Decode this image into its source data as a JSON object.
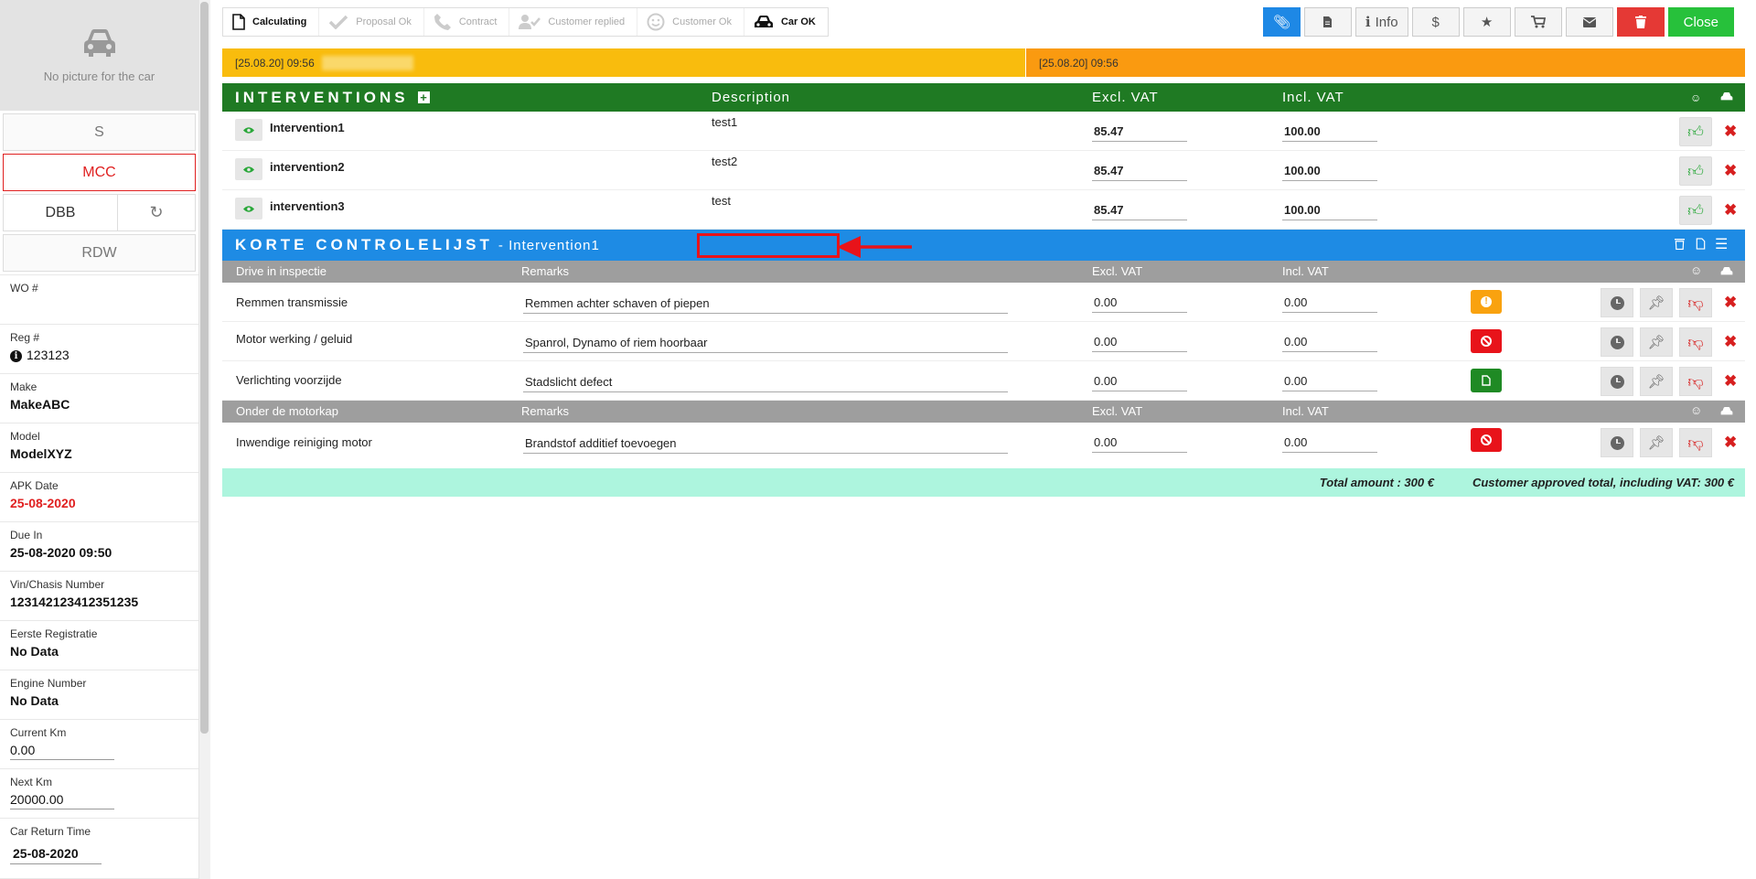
{
  "sidebar": {
    "no_picture": "No picture for the car",
    "buttons": {
      "s": "S",
      "mcc": "MCC",
      "dbb": "DBB",
      "rdw": "RDW"
    },
    "fields": [
      {
        "label": "WO #",
        "value": ""
      },
      {
        "label": "Reg #",
        "value": "123123"
      },
      {
        "label": "Make",
        "value": "MakeABC"
      },
      {
        "label": "Model",
        "value": "ModelXYZ"
      },
      {
        "label": "APK Date",
        "value": "25-08-2020"
      },
      {
        "label": "Due In",
        "value": "25-08-2020 09:50"
      },
      {
        "label": "Vin/Chasis Number",
        "value": "123142123412351235"
      },
      {
        "label": "Eerste Registratie",
        "value": "No Data"
      },
      {
        "label": "Engine Number",
        "value": "No Data"
      },
      {
        "label": "Current Km",
        "value": "0.00"
      },
      {
        "label": "Next Km",
        "value": "20000.00"
      },
      {
        "label": "Car Return Time",
        "value": "25-08-2020"
      }
    ]
  },
  "steps": [
    {
      "label": "Calculating",
      "icon": "document-icon",
      "active": true
    },
    {
      "label": "Proposal Ok",
      "icon": "check-icon",
      "active": false
    },
    {
      "label": "Contract",
      "icon": "phone-icon",
      "active": false
    },
    {
      "label": "Customer replied",
      "icon": "user-check-icon",
      "active": false
    },
    {
      "label": "Customer Ok",
      "icon": "smiley-icon",
      "active": false
    },
    {
      "label": "Car OK",
      "icon": "car-icon",
      "active": true
    }
  ],
  "toolbar": {
    "info": "Info",
    "dollar": "$",
    "close": "Close"
  },
  "notes": [
    "[25.08.20] 09:56",
    "[25.08.20] 09:56"
  ],
  "interventions": {
    "title": "INTERVENTIONS",
    "col_description": "Description",
    "col_excl": "Excl. VAT",
    "col_incl": "Incl. VAT",
    "rows": [
      {
        "name": "Intervention1",
        "description": "test1",
        "excl": "85.47",
        "incl": "100.00"
      },
      {
        "name": "intervention2",
        "description": "test2",
        "excl": "85.47",
        "incl": "100.00"
      },
      {
        "name": "intervention3",
        "description": "test",
        "excl": "85.47",
        "incl": "100.00"
      }
    ]
  },
  "checklist": {
    "title": "KORTE CONTROLELIJST",
    "subtitle": "- Intervention1",
    "groups": [
      {
        "name": "Drive in inspectie",
        "remarks": "Remarks",
        "excl": "Excl. VAT",
        "incl": "Incl. VAT",
        "items": [
          {
            "name": "Remmen transmissie",
            "remark": "Remmen achter schaven of piepen",
            "excl": "0.00",
            "incl": "0.00",
            "status": "warning",
            "color": "#f9a20f"
          },
          {
            "name": "Motor werking / geluid",
            "remark": "Spanrol, Dynamo of riem hoorbaar",
            "excl": "0.00",
            "incl": "0.00",
            "status": "blocked",
            "color": "#e8131a"
          },
          {
            "name": "Verlichting voorzijde",
            "remark": "Stadslicht defect",
            "excl": "0.00",
            "incl": "0.00",
            "status": "ok",
            "color": "#1f8a24"
          }
        ]
      },
      {
        "name": "Onder de motorkap",
        "remarks": "Remarks",
        "excl": "Excl. VAT",
        "incl": "Incl. VAT",
        "items": [
          {
            "name": "Inwendige reiniging motor",
            "remark": "Brandstof additief toevoegen",
            "excl": "0.00",
            "incl": "0.00",
            "status": "blocked",
            "color": "#e8131a"
          }
        ]
      }
    ]
  },
  "totals": {
    "total_amount": "Total amount : 300 €",
    "approved_total": "Customer approved total, including VAT: 300 €"
  }
}
